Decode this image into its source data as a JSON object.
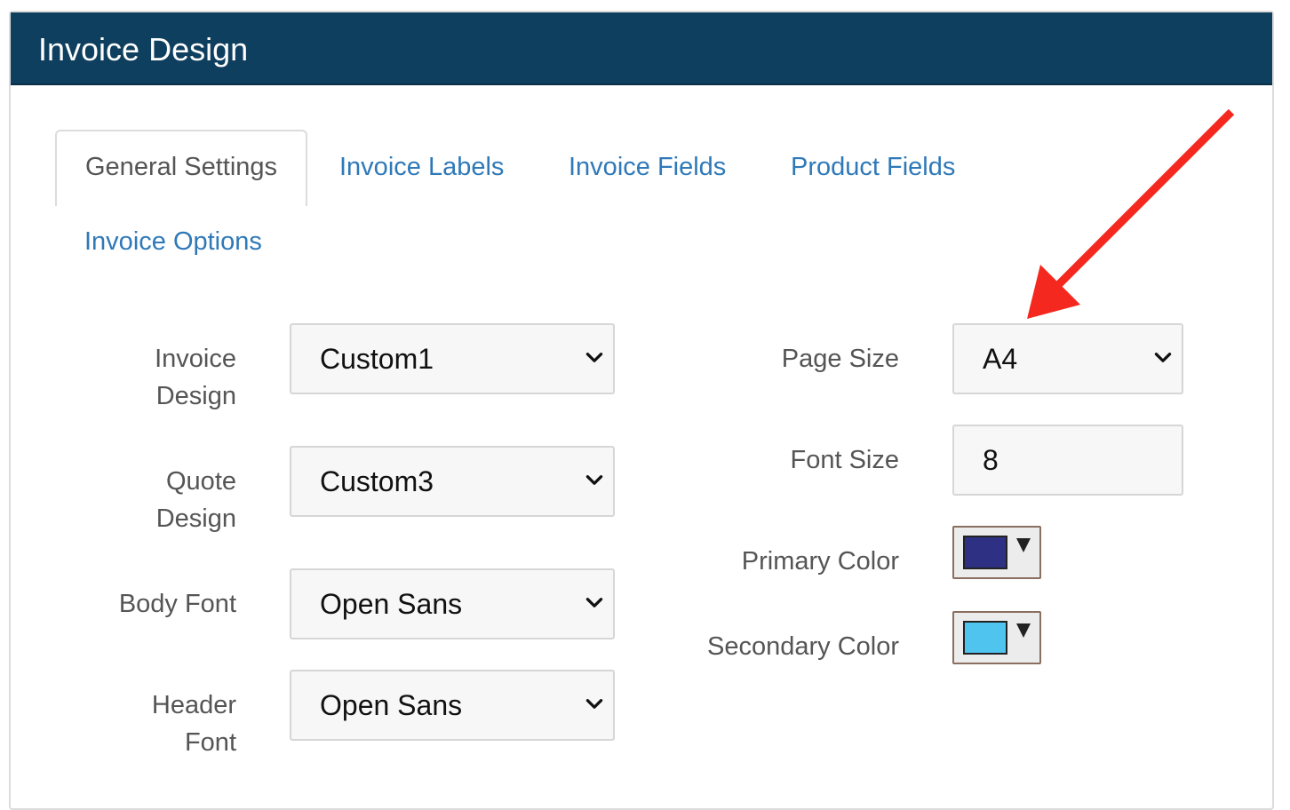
{
  "panel": {
    "title": "Invoice Design"
  },
  "tabs": [
    {
      "label": "General Settings",
      "active": true
    },
    {
      "label": "Invoice Labels",
      "active": false
    },
    {
      "label": "Invoice Fields",
      "active": false
    },
    {
      "label": "Product Fields",
      "active": false
    },
    {
      "label": "Invoice Options",
      "active": false
    }
  ],
  "left_fields": [
    {
      "label_line1": "Invoice",
      "label_line2": "Design",
      "value": "Custom1"
    },
    {
      "label_line1": "Quote",
      "label_line2": "Design",
      "value": "Custom3"
    },
    {
      "label_line1": "Body Font",
      "label_line2": "",
      "value": "Open Sans"
    },
    {
      "label_line1": "Header",
      "label_line2": "Font",
      "value": "Open Sans"
    }
  ],
  "right_fields": {
    "page_size": {
      "label": "Page Size",
      "value": "A4"
    },
    "font_size": {
      "label": "Font Size",
      "value": "8"
    },
    "primary_color": {
      "label": "Primary Color",
      "color": "#2e3083"
    },
    "secondary_color": {
      "label": "Secondary Color",
      "color": "#4fc4ee"
    }
  },
  "colors": {
    "header_bg": "#0f3f5e",
    "tab_link": "#2f79b8",
    "annotation_arrow": "#f4281e"
  },
  "icons": {
    "select_caret": "chevron-down-icon",
    "color_caret": "triangle-down-icon",
    "annotation": "red-arrow-icon"
  }
}
